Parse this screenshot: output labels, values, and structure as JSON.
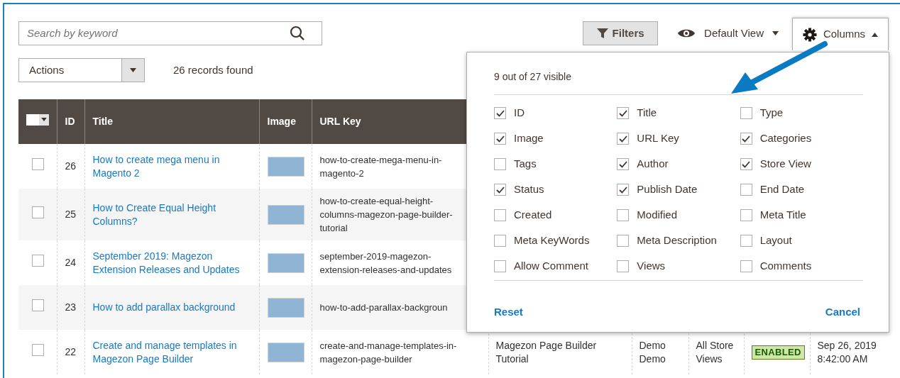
{
  "search": {
    "placeholder": "Search by keyword"
  },
  "toolbar": {
    "filters": "Filters",
    "view": "Default View",
    "columns": "Columns",
    "columns_open": true
  },
  "actions": {
    "label": "Actions"
  },
  "records": "26 records found",
  "table": {
    "columns": [
      "ID",
      "Title",
      "Image",
      "URL Key"
    ],
    "header_checkbox": {
      "checked": false
    },
    "rows": [
      {
        "selected": false,
        "id": "26",
        "title": "How to create mega menu in Magento 2",
        "url_key": "how-to-create-mega-menu-in-magento-2",
        "more_cells": []
      },
      {
        "selected": false,
        "id": "25",
        "title": "How to Create Equal Height Columns?",
        "url_key": "how-to-create-equal-height-columns-magezon-page-builder-tutorial",
        "more_cells": []
      },
      {
        "selected": false,
        "id": "24",
        "title": "September 2019: Magezon Extension Releases and Updates",
        "url_key": "september-2019-magezon-extension-releases-and-updates",
        "more_cells": []
      },
      {
        "selected": false,
        "id": "23",
        "title": "How to add parallax background",
        "url_key": "how-to-add-parallax-backgroun",
        "more_cells": []
      },
      {
        "selected": false,
        "id": "22",
        "title": "Create and manage templates in Magezon Page Builder",
        "url_key": "create-and-manage-templates-in-magezon-page-builder",
        "more_cells": [
          {
            "kind": "text",
            "text": "Magezon Page Builder Tutorial"
          },
          {
            "kind": "text",
            "text": "Demo Demo"
          },
          {
            "kind": "text",
            "text": "All Store Views"
          },
          {
            "kind": "badge",
            "text": "ENABLED"
          },
          {
            "kind": "text",
            "text": "Sep 26, 2019 8:42:00 AM"
          }
        ]
      }
    ]
  },
  "column_panel": {
    "summary": "9 out of 27 visible",
    "options": [
      {
        "label": "ID",
        "checked": true
      },
      {
        "label": "Title",
        "checked": true
      },
      {
        "label": "Type",
        "checked": false
      },
      {
        "label": "Image",
        "checked": true
      },
      {
        "label": "URL Key",
        "checked": true
      },
      {
        "label": "Categories",
        "checked": true
      },
      {
        "label": "Tags",
        "checked": false
      },
      {
        "label": "Author",
        "checked": true
      },
      {
        "label": "Store View",
        "checked": true
      },
      {
        "label": "Status",
        "checked": true
      },
      {
        "label": "Publish Date",
        "checked": true
      },
      {
        "label": "End Date",
        "checked": false
      },
      {
        "label": "Created",
        "checked": false
      },
      {
        "label": "Modified",
        "checked": false
      },
      {
        "label": "Meta Title",
        "checked": false
      },
      {
        "label": "Meta KeyWords",
        "checked": false
      },
      {
        "label": "Meta Description",
        "checked": false
      },
      {
        "label": "Layout",
        "checked": false
      },
      {
        "label": "Allow Comment",
        "checked": false
      },
      {
        "label": "Views",
        "checked": false
      },
      {
        "label": "Comments",
        "checked": false
      }
    ],
    "reset": "Reset",
    "cancel": "Cancel"
  }
}
